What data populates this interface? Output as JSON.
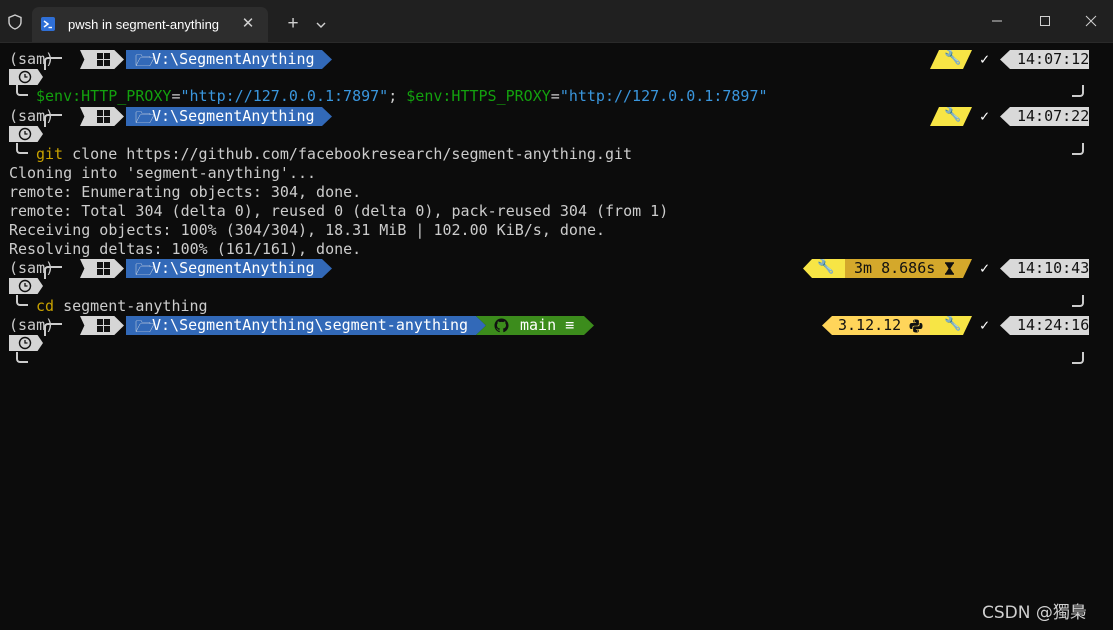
{
  "window": {
    "tab_title": "pwsh in segment-anything",
    "tab_close": "✕",
    "new_tab": "+",
    "colors": {
      "titlebar": "#202020",
      "tab": "#2d2d2d",
      "terminal_bg": "#0c0c0c"
    }
  },
  "prompt_common": {
    "env": "(sam)",
    "check": "✓"
  },
  "blocks": [
    {
      "path": "V:\\SegmentAnything",
      "time": "14:07:12",
      "command_parts": [
        {
          "text": "$env:HTTP_PROXY",
          "cls": "green"
        },
        {
          "text": "=",
          "cls": "gray"
        },
        {
          "text": "\"http://127.0.0.1:7897\"",
          "cls": "blue"
        },
        {
          "text": "; ",
          "cls": "gray"
        },
        {
          "text": "$env:HTTPS_PROXY",
          "cls": "green"
        },
        {
          "text": "=",
          "cls": "gray"
        },
        {
          "text": "\"http://127.0.0.1:7897\"",
          "cls": "blue"
        }
      ]
    },
    {
      "path": "V:\\SegmentAnything",
      "time": "14:07:22",
      "command_parts": [
        {
          "text": "git",
          "cls": "yellow"
        },
        {
          "text": " clone https://github.com/facebookresearch/segment-anything.git",
          "cls": "gray"
        }
      ],
      "output": [
        "Cloning into 'segment-anything'...",
        "remote: Enumerating objects: 304, done.",
        "remote: Total 304 (delta 0), reused 0 (delta 0), pack-reused 304 (from 1)",
        "Receiving objects: 100% (304/304), 18.31 MiB | 102.00 KiB/s, done.",
        "Resolving deltas: 100% (161/161), done."
      ]
    },
    {
      "path": "V:\\SegmentAnything",
      "time": "14:10:43",
      "duration": "3m 8.686s",
      "command_parts": [
        {
          "text": "cd",
          "cls": "yellow"
        },
        {
          "text": " segment-anything",
          "cls": "gray"
        }
      ]
    },
    {
      "path": "V:\\SegmentAnything\\segment-anything",
      "git_branch": "main ≡",
      "python_version": "3.12.12",
      "time": "14:24:16"
    }
  ],
  "watermark": "CSDN @獨梟"
}
